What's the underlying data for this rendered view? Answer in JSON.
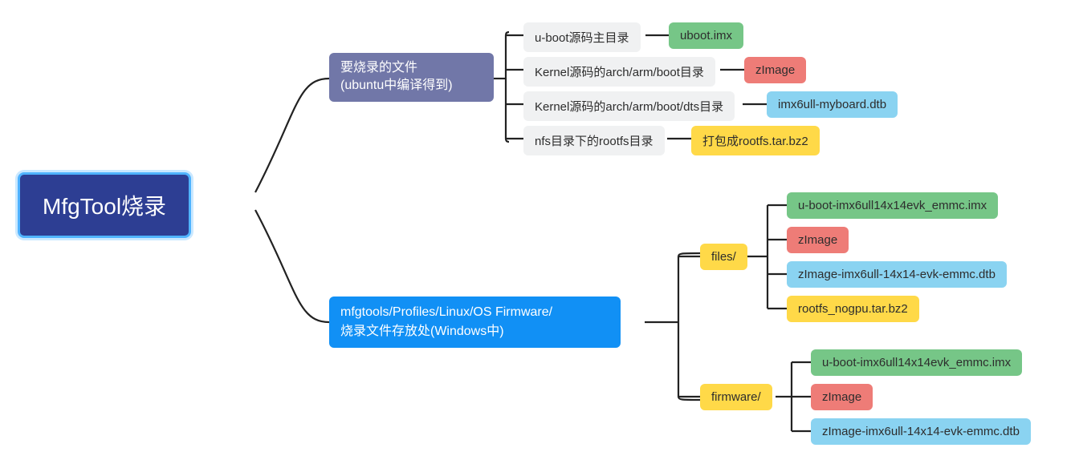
{
  "root": {
    "label": "MfgTool烧录"
  },
  "branch1": {
    "label": "要烧录的文件\n(ubuntu中编译得到)",
    "items": [
      {
        "source": "u-boot源码主目录",
        "output": "uboot.imx",
        "outColor": "green"
      },
      {
        "source": "Kernel源码的arch/arm/boot目录",
        "output": "zImage",
        "outColor": "red"
      },
      {
        "source": "Kernel源码的arch/arm/boot/dts目录",
        "output": "imx6ull-myboard.dtb",
        "outColor": "skyblue"
      },
      {
        "source": "nfs目录下的rootfs目录",
        "output": "打包成rootfs.tar.bz2",
        "outColor": "yellow"
      }
    ]
  },
  "branch2": {
    "label": "mfgtools/Profiles/Linux/OS Firmware/\n烧录文件存放处(Windows中)",
    "folders": [
      {
        "name": "files/",
        "files": [
          {
            "name": "u-boot-imx6ull14x14evk_emmc.imx",
            "color": "green"
          },
          {
            "name": "zImage",
            "color": "red"
          },
          {
            "name": "zImage-imx6ull-14x14-evk-emmc.dtb",
            "color": "skyblue"
          },
          {
            "name": "rootfs_nogpu.tar.bz2",
            "color": "yellow"
          }
        ]
      },
      {
        "name": "firmware/",
        "files": [
          {
            "name": "u-boot-imx6ull14x14evk_emmc.imx",
            "color": "green"
          },
          {
            "name": "zImage",
            "color": "red"
          },
          {
            "name": "zImage-imx6ull-14x14-evk-emmc.dtb",
            "color": "skyblue"
          }
        ]
      }
    ]
  }
}
